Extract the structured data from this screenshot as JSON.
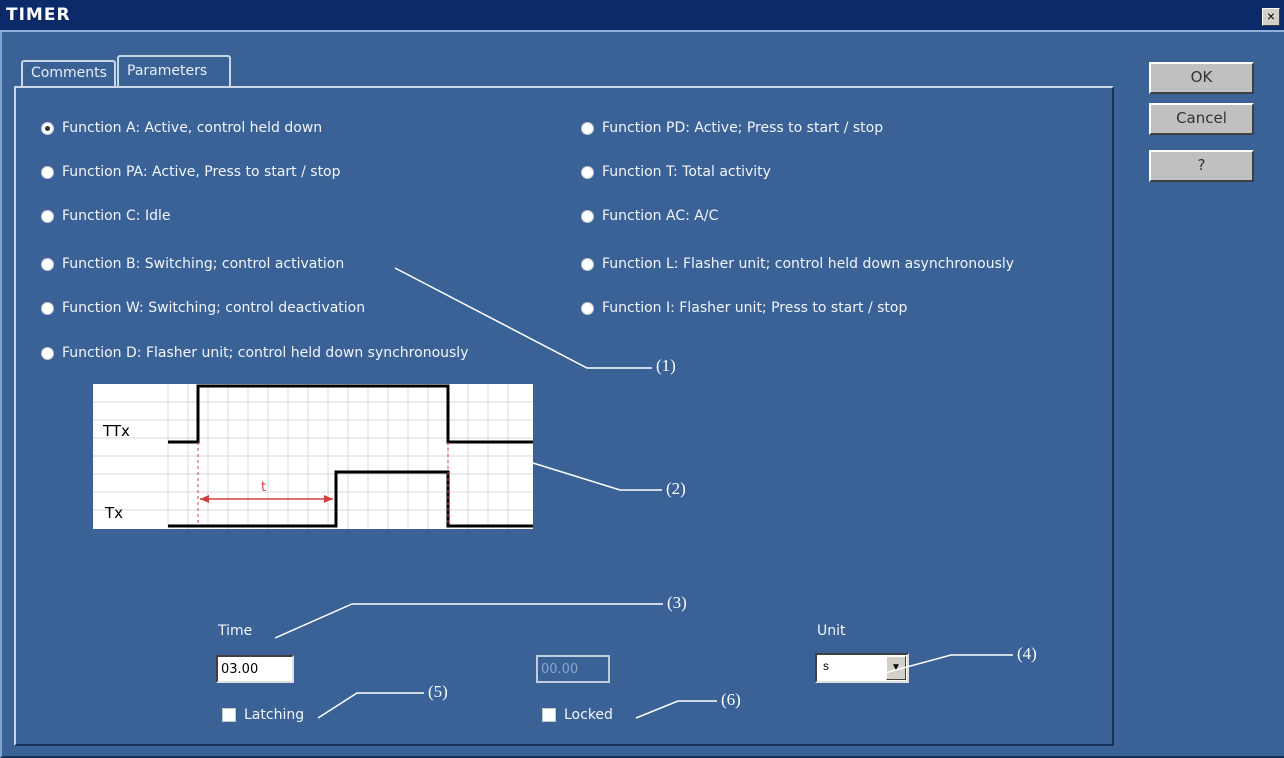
{
  "window": {
    "title": "TIMER",
    "close_glyph": "×"
  },
  "tabs": [
    {
      "label": "Comments"
    },
    {
      "label": "Parameters"
    }
  ],
  "buttons": {
    "ok": "OK",
    "cancel": "Cancel",
    "help": "?"
  },
  "functions_left": [
    {
      "label": "Function A: Active, control held down",
      "selected": true
    },
    {
      "label": "Function PA: Active, Press to start / stop",
      "selected": false
    },
    {
      "label": "Function C: Idle",
      "selected": false
    },
    {
      "label": "Function B: Switching; control activation",
      "selected": false
    },
    {
      "label": "Function W: Switching; control deactivation",
      "selected": false
    },
    {
      "label": "Function D: Flasher unit; control held down synchronously",
      "selected": false
    }
  ],
  "functions_right": [
    {
      "label": "Function PD: Active; Press to start / stop",
      "selected": false
    },
    {
      "label": "Function T: Total activity",
      "selected": false
    },
    {
      "label": "Function AC: A/C",
      "selected": false
    },
    {
      "label": "Function L: Flasher unit; control held down asynchronously",
      "selected": false
    },
    {
      "label": "Function I: Flasher unit; Press to start / stop",
      "selected": false
    }
  ],
  "diagram": {
    "ttx_label": "TTx",
    "tx_label": "Tx",
    "t_label": "t",
    "signal_color": "#000000",
    "annotation_color": "#d04040"
  },
  "time": {
    "label": "Time",
    "value": "03.00",
    "disabled_value": "00.00"
  },
  "unit": {
    "label": "Unit",
    "value": "s"
  },
  "latching": {
    "label": "Latching",
    "checked": false
  },
  "locked": {
    "label": "Locked",
    "checked": false
  },
  "callouts": [
    "(1)",
    "(2)",
    "(3)",
    "(4)",
    "(5)",
    "(6)"
  ],
  "colors": {
    "background": "#3a6296",
    "titlebar": "#0a2a6a"
  }
}
